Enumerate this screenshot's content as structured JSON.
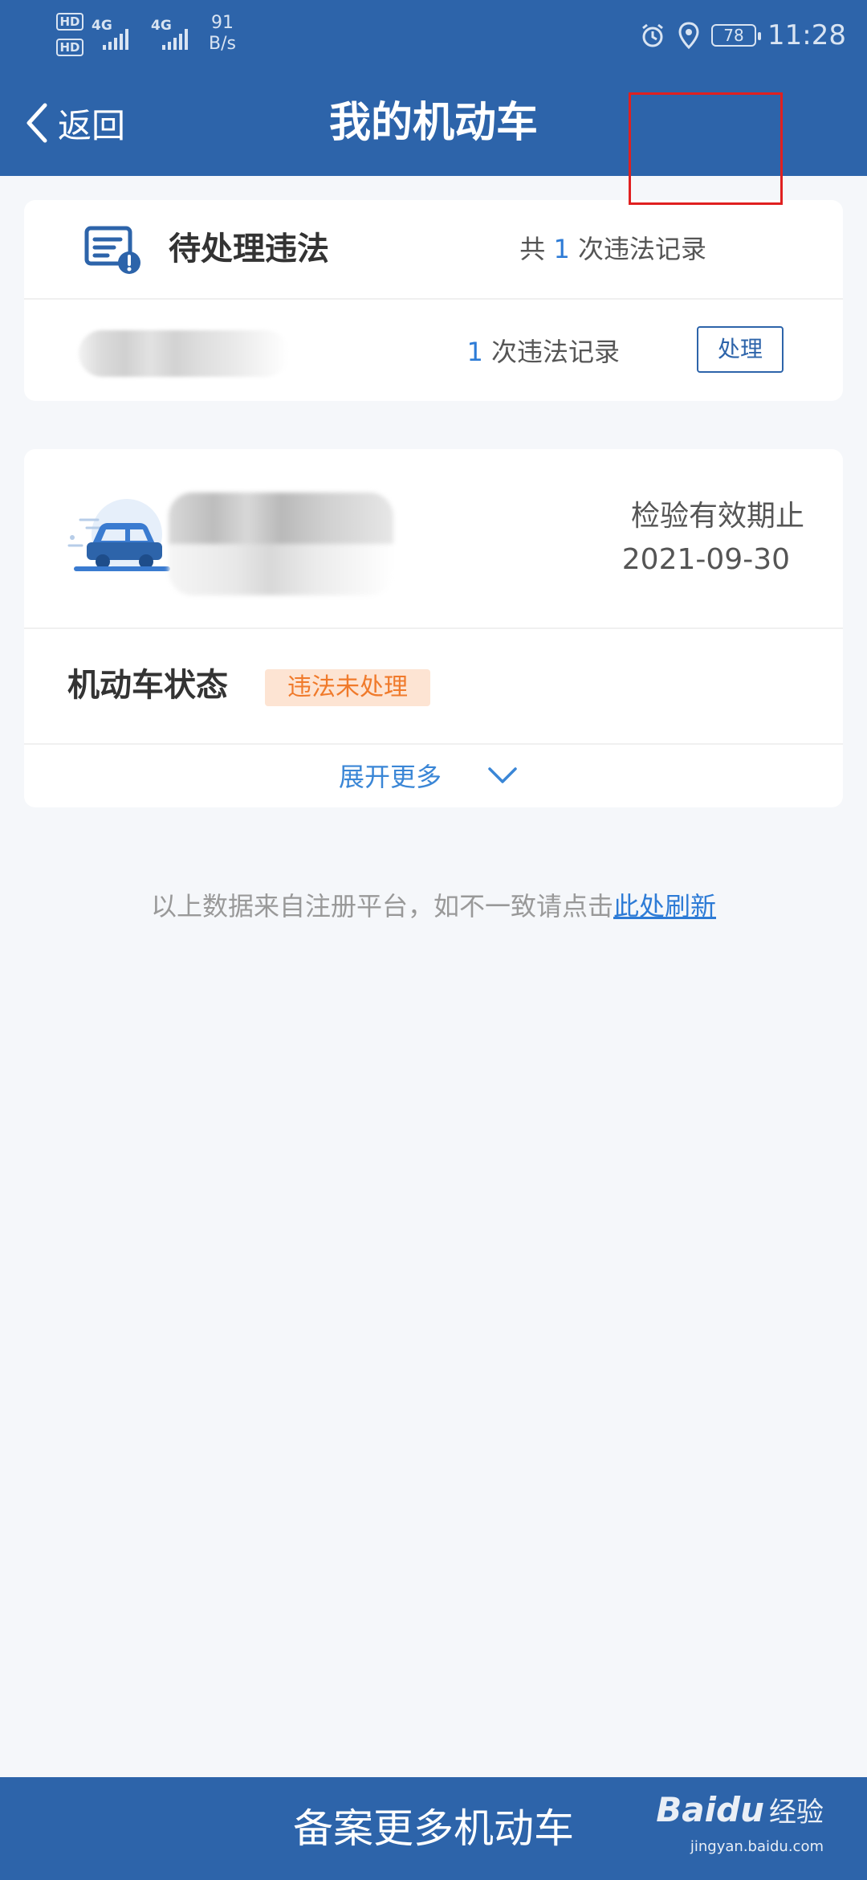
{
  "status_bar": {
    "hd1": "HD",
    "hd2": "HD",
    "sig1": "4G",
    "sig2": "4G",
    "speed_value": "91",
    "speed_unit": "B/s",
    "battery": "78",
    "time": "11:28"
  },
  "nav": {
    "back_label": "返回",
    "title": "我的机动车"
  },
  "pending": {
    "title": "待处理违法",
    "total_prefix": "共 ",
    "total_count": "1",
    "total_suffix": " 次违法记录",
    "item_count": "1",
    "item_suffix": " 次违法记录",
    "handle_label": "处理"
  },
  "vehicle": {
    "validity_label": "检验有效期止",
    "validity_date": "2021-09-30",
    "status_label": "机动车状态",
    "status_badge": "违法未处理",
    "expand_label": "展开更多"
  },
  "footer": {
    "note": "以上数据来自注册平台，如不一致请点击",
    "refresh_link": "此处刷新"
  },
  "bottom_button": "备案更多机动车",
  "watermark": {
    "brand": "Baidu",
    "cn": "经验",
    "url": "jingyan.baidu.com"
  },
  "colors": {
    "primary": "#2d64aa",
    "accent_blue": "#2d7bd6",
    "badge_bg": "#fde4d3",
    "badge_text": "#f07a2b",
    "highlight_red": "#e02020"
  }
}
